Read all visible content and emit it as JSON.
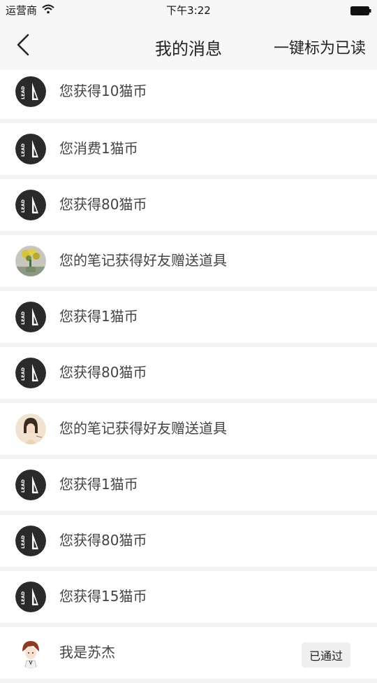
{
  "status_bar": {
    "carrier": "运营商",
    "time": "下午3:22",
    "wifi_icon": "wifi-icon",
    "battery_icon": "battery-icon"
  },
  "nav": {
    "title": "我的消息",
    "mark_all_read": "一键标为已读",
    "back_icon": "chevron-left-icon"
  },
  "messages": [
    {
      "text": "您获得10猫币",
      "avatar": "lead-logo"
    },
    {
      "text": "您消费1猫币",
      "avatar": "lead-logo"
    },
    {
      "text": "您获得80猫币",
      "avatar": "lead-logo"
    },
    {
      "text": "您的笔记获得好友赠送道具",
      "avatar": "user-photo-flowers"
    },
    {
      "text": "您获得1猫币",
      "avatar": "lead-logo"
    },
    {
      "text": "您获得80猫币",
      "avatar": "lead-logo"
    },
    {
      "text": "您的笔记获得好友赠送道具",
      "avatar": "user-photo-girl"
    },
    {
      "text": "您获得1猫币",
      "avatar": "lead-logo"
    },
    {
      "text": "您获得80猫币",
      "avatar": "lead-logo"
    },
    {
      "text": "您获得15猫币",
      "avatar": "lead-logo"
    },
    {
      "text": "我是苏杰",
      "avatar": "user-photo-boy",
      "badge": "已通过"
    }
  ],
  "colors": {
    "background": "#f4f4f4",
    "row_background": "#ffffff",
    "logo_background": "#2a2a2a",
    "badge_background": "#efefef"
  }
}
